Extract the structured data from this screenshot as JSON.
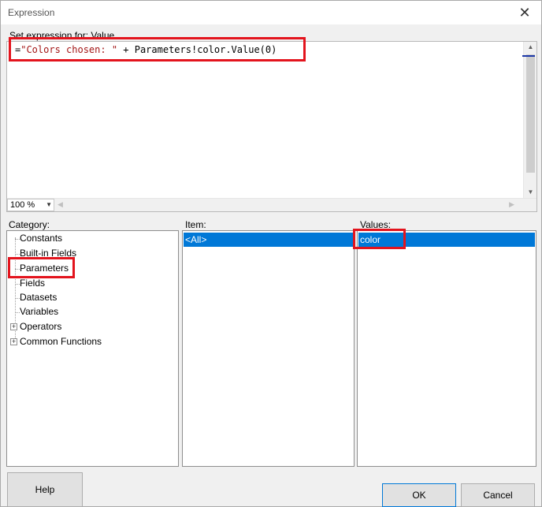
{
  "window": {
    "title": "Expression",
    "close_glyph": "✕"
  },
  "set_expression_label": "Set expression for: Value",
  "expression": {
    "prefix": "=",
    "string_literal": "\"Colors chosen: \"",
    "rest": " + Parameters!color.Value(0)"
  },
  "zoom": {
    "value": "100 %"
  },
  "category": {
    "label": "Category:",
    "items": [
      {
        "label": "Constants",
        "expandable": false
      },
      {
        "label": "Built-in Fields",
        "expandable": false
      },
      {
        "label": "Parameters",
        "expandable": false,
        "highlighted": true
      },
      {
        "label": "Fields",
        "expandable": false
      },
      {
        "label": "Datasets",
        "expandable": false
      },
      {
        "label": "Variables",
        "expandable": false
      },
      {
        "label": "Operators",
        "expandable": true
      },
      {
        "label": "Common Functions",
        "expandable": true
      }
    ]
  },
  "item": {
    "label": "Item:",
    "selected": "<All>"
  },
  "values": {
    "label": "Values:",
    "selected": "color"
  },
  "buttons": {
    "help": "Help",
    "ok": "OK",
    "cancel": "Cancel"
  },
  "colors": {
    "selection": "#0078d7",
    "highlight_box": "#e3141d",
    "string_literal": "#a31515"
  }
}
